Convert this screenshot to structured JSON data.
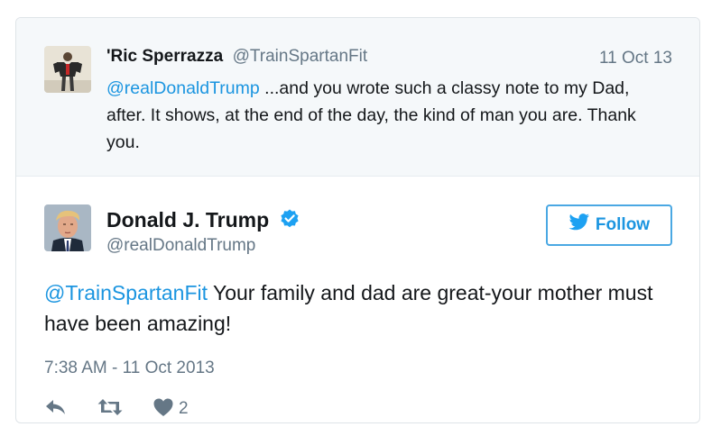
{
  "parent_tweet": {
    "display_name": "'Ric Sperrazza",
    "handle": "@TrainSpartanFit",
    "date": "11 Oct 13",
    "mention": "@realDonaldTrump",
    "text": " ...and you wrote such a classy note to my Dad, after. It shows, at the end of the day, the kind of man you are. Thank you."
  },
  "tweet": {
    "display_name": "Donald J. Trump",
    "handle": "@realDonaldTrump",
    "verified": true,
    "follow_label": "Follow",
    "mention": "@TrainSpartanFit",
    "text": " Your family and dad are great-your mother must have been amazing!",
    "timestamp": "7:38 AM - 11 Oct 2013",
    "like_count": "2"
  },
  "icons": {
    "verified": "verified-badge-icon",
    "follow": "twitter-bird-icon",
    "reply": "reply-icon",
    "retweet": "retweet-icon",
    "like": "heart-icon"
  },
  "colors": {
    "link": "#1b95e0",
    "secondary_text": "#657786",
    "parent_background": "#f5f8fa",
    "verified": "#1da1f2"
  }
}
